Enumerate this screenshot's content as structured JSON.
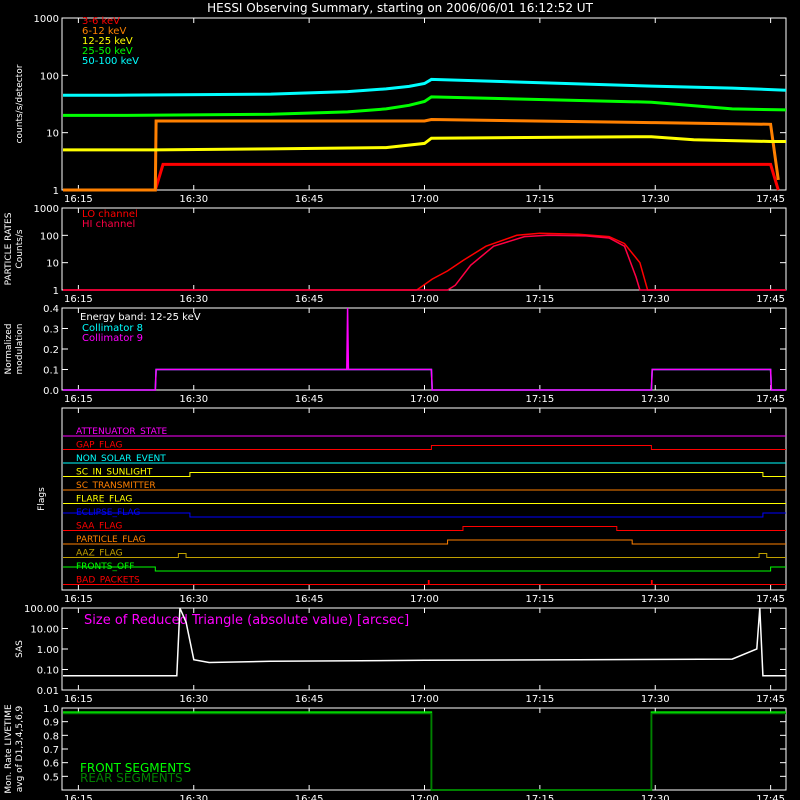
{
  "title": "HESSI Observing Summary, starting on 2006/06/01 16:12:52 UT",
  "colors": {
    "red": "#ff0000",
    "orange": "#ff8000",
    "yellow": "#ffff00",
    "green": "#00ff00",
    "cyan": "#00ffff",
    "magenta": "#ff00ff",
    "white": "#ffffff",
    "blue": "#0000ff",
    "olive": "#c0a000",
    "frame": "#ffffff"
  },
  "time_ticks": [
    "16:15",
    "16:30",
    "16:45",
    "17:00",
    "17:15",
    "17:30",
    "17:45"
  ],
  "time_ticks_minutes": [
    15,
    30,
    45,
    60,
    75,
    90,
    105
  ],
  "time_range_minutes": [
    12.87,
    107
  ],
  "chart_data": [
    {
      "id": "count-rates",
      "type": "line",
      "ylabel": "counts/s/detector",
      "yscale": "log",
      "ylim": [
        1,
        1000
      ],
      "yticks": [
        "1",
        "10",
        "100",
        "1000"
      ],
      "yticks_values": [
        1,
        10,
        100,
        1000
      ],
      "data_gap_minutes": [
        60.9,
        89.5
      ],
      "series": [
        {
          "name": "3-6 keV",
          "color": "#ff0000",
          "x": [
            13,
            25,
            26,
            60,
            60.9,
            89.5,
            90,
            105,
            106
          ],
          "y": [
            1,
            1,
            2.8,
            2.8,
            2.8,
            2.8,
            2.8,
            2.8,
            1
          ]
        },
        {
          "name": "6-12 keV",
          "color": "#ff8000",
          "x": [
            13,
            25,
            25.1,
            60,
            60.9,
            89.5,
            90,
            105,
            106
          ],
          "y": [
            1,
            1,
            16,
            16,
            17,
            15,
            15,
            14,
            1.5
          ]
        },
        {
          "name": "12-25 keV",
          "color": "#ffff00",
          "x": [
            13,
            25,
            40,
            55,
            60,
            60.9,
            89.5,
            95,
            105,
            107
          ],
          "y": [
            5,
            5,
            5.2,
            5.5,
            6.5,
            8,
            8.5,
            7.5,
            7,
            7
          ]
        },
        {
          "name": "25-50 keV",
          "color": "#00ff00",
          "x": [
            13,
            20,
            40,
            50,
            55,
            58,
            60,
            60.9,
            89.5,
            100,
            107
          ],
          "y": [
            20,
            20,
            21,
            23,
            26,
            30,
            35,
            42,
            34,
            26,
            25
          ]
        },
        {
          "name": "50-100 keV",
          "color": "#00ffff",
          "x": [
            13,
            20,
            40,
            50,
            55,
            58,
            60,
            60.9,
            89.5,
            100,
            107
          ],
          "y": [
            45,
            45,
            47,
            52,
            58,
            64,
            72,
            85,
            65,
            60,
            55
          ]
        }
      ]
    },
    {
      "id": "particle-rates",
      "type": "line",
      "ylabel": "PARTICLE RATES Counts/s",
      "yscale": "log",
      "ylim": [
        1,
        1000
      ],
      "yticks": [
        "1",
        "10",
        "100",
        "1000"
      ],
      "yticks_values": [
        1,
        10,
        100,
        1000
      ],
      "series": [
        {
          "name": "LO channel",
          "color": "#ff0000",
          "x": [
            13,
            59,
            61,
            63,
            65,
            68,
            72,
            75,
            80,
            84,
            86,
            88,
            89,
            107
          ],
          "y": [
            1,
            1,
            2.5,
            5,
            12,
            40,
            100,
            120,
            110,
            90,
            50,
            10,
            1,
            1
          ]
        },
        {
          "name": "HI channel",
          "color": "#ff0044",
          "x": [
            13,
            63,
            64,
            66,
            69,
            73,
            76,
            81,
            84,
            86,
            87.5,
            88,
            107
          ],
          "y": [
            1,
            1,
            1.5,
            8,
            40,
            90,
            100,
            95,
            80,
            40,
            3,
            1,
            1
          ]
        }
      ]
    },
    {
      "id": "modulation",
      "type": "line",
      "ylabel": "Normalized modulation",
      "yscale": "linear",
      "ylim": [
        0,
        0.4
      ],
      "yticks": [
        "0.0",
        "0.1",
        "0.2",
        "0.3",
        "0.4"
      ],
      "yticks_values": [
        0,
        0.1,
        0.2,
        0.3,
        0.4
      ],
      "annotation": "Energy band: 12-25 keV",
      "series": [
        {
          "name": "Collimator 8",
          "color": "#00ffff",
          "x": [
            13,
            25,
            25.1,
            60.9,
            61,
            89.5,
            89.6,
            105,
            105.1,
            107
          ],
          "y": [
            0,
            0,
            0.1,
            0.1,
            0,
            0,
            0.1,
            0.1,
            0,
            0
          ]
        },
        {
          "name": "Collimator 9",
          "color": "#ff00ff",
          "x": [
            13,
            25,
            25.1,
            49.9,
            50,
            50.1,
            60.9,
            61,
            89.5,
            89.6,
            105,
            105.1,
            107
          ],
          "y": [
            0,
            0,
            0.1,
            0.1,
            0.4,
            0.1,
            0.1,
            0,
            0,
            0.1,
            0.1,
            0,
            0
          ]
        }
      ]
    },
    {
      "id": "flags",
      "type": "line",
      "ylabel": "Flags",
      "series": [
        {
          "name": "ATTENUATOR_STATE",
          "color": "#ff00ff",
          "x": [
            13,
            107
          ],
          "y": [
            0,
            0
          ]
        },
        {
          "name": "GAP_FLAG",
          "color": "#ff0000",
          "x": [
            13,
            60.9,
            60.9,
            89.5,
            89.5,
            107
          ],
          "y": [
            0,
            0,
            1,
            1,
            0,
            0
          ]
        },
        {
          "name": "NON_SOLAR_EVENT",
          "color": "#00ffff",
          "x": [
            13,
            107
          ],
          "y": [
            0,
            0
          ]
        },
        {
          "name": "SC_IN_SUNLIGHT",
          "color": "#ffff00",
          "x": [
            13,
            29.5,
            29.5,
            104,
            104,
            107
          ],
          "y": [
            0,
            0,
            1,
            1,
            0,
            0
          ]
        },
        {
          "name": "SC_TRANSMITTER",
          "color": "#ff8000",
          "x": [
            13,
            107
          ],
          "y": [
            0,
            0
          ]
        },
        {
          "name": "FLARE_FLAG",
          "color": "#ffff00",
          "x": [
            13,
            107
          ],
          "y": [
            0,
            0
          ]
        },
        {
          "name": "ECLIPSE_FLAG",
          "color": "#0000ff",
          "x": [
            13,
            29.5,
            29.5,
            104,
            104,
            107
          ],
          "y": [
            1,
            1,
            0,
            0,
            1,
            1
          ]
        },
        {
          "name": "SAA_FLAG",
          "color": "#ff0000",
          "x": [
            13,
            65,
            65,
            85,
            85,
            107
          ],
          "y": [
            0,
            0,
            1,
            1,
            0,
            0
          ]
        },
        {
          "name": "PARTICLE_FLAG",
          "color": "#ff8000",
          "x": [
            13,
            63,
            63,
            87,
            87,
            107
          ],
          "y": [
            0,
            0,
            1,
            1,
            0,
            0
          ]
        },
        {
          "name": "AAZ_FLAG",
          "color": "#c0a000",
          "x": [
            13,
            28,
            28,
            29,
            29,
            103.5,
            103.5,
            104.5,
            104.5,
            107
          ],
          "y": [
            0,
            0,
            1,
            1,
            0,
            0,
            1,
            1,
            0,
            0
          ]
        },
        {
          "name": "FRONTS_OFF",
          "color": "#00ff00",
          "x": [
            13,
            25,
            25,
            105,
            105,
            107
          ],
          "y": [
            1,
            1,
            0,
            0,
            1,
            1
          ]
        },
        {
          "name": "BAD_PACKETS",
          "color": "#ff0000",
          "x": [
            13,
            60.5,
            60.5,
            60.6,
            60.6,
            89.5,
            89.5,
            89.6,
            89.6,
            107
          ],
          "y": [
            0,
            0,
            1,
            1,
            0,
            0,
            1,
            1,
            0,
            0
          ]
        }
      ]
    },
    {
      "id": "sas",
      "type": "line",
      "ylabel": "SAS",
      "yscale": "log",
      "ylim": [
        0.01,
        100
      ],
      "yticks": [
        "0.01",
        "0.10",
        "1.00",
        "10.00",
        "100.00"
      ],
      "yticks_values": [
        0.01,
        0.1,
        1,
        10,
        100
      ],
      "annotation": "Size of Reduced Triangle (absolute value) [arcsec]",
      "series": [
        {
          "name": "",
          "color": "#ffffff",
          "x": [
            13,
            27.8,
            28.2,
            29,
            30,
            32,
            40,
            60,
            80,
            100,
            103.2,
            103.6,
            104,
            107
          ],
          "y": [
            0.05,
            0.05,
            100,
            20,
            0.3,
            0.22,
            0.25,
            0.28,
            0.3,
            0.32,
            1,
            100,
            0.05,
            0.05
          ]
        }
      ]
    },
    {
      "id": "livetime",
      "type": "line",
      "ylabel": "Mon. Rate LIVETIME avg of D1,3,4,5,6,9",
      "yscale": "linear",
      "ylim": [
        0.4,
        1.0
      ],
      "yticks": [
        "0.5",
        "0.6",
        "0.7",
        "0.8",
        "0.9",
        "1.0"
      ],
      "yticks_values": [
        0.5,
        0.6,
        0.7,
        0.8,
        0.9,
        1.0
      ],
      "series": [
        {
          "name": "FRONT SEGMENTS",
          "color": "#00ff00",
          "x": [
            13,
            60.9,
            60.9,
            89.5,
            89.5,
            107
          ],
          "y": [
            0.97,
            0.97,
            0.4,
            0.4,
            0.97,
            0.97
          ]
        },
        {
          "name": "REAR SEGMENTS",
          "color": "#008000",
          "x": [
            13,
            60.9,
            60.9,
            89.5,
            89.5,
            107
          ],
          "y": [
            0.96,
            0.96,
            0.4,
            0.4,
            0.96,
            0.96
          ]
        }
      ]
    }
  ]
}
